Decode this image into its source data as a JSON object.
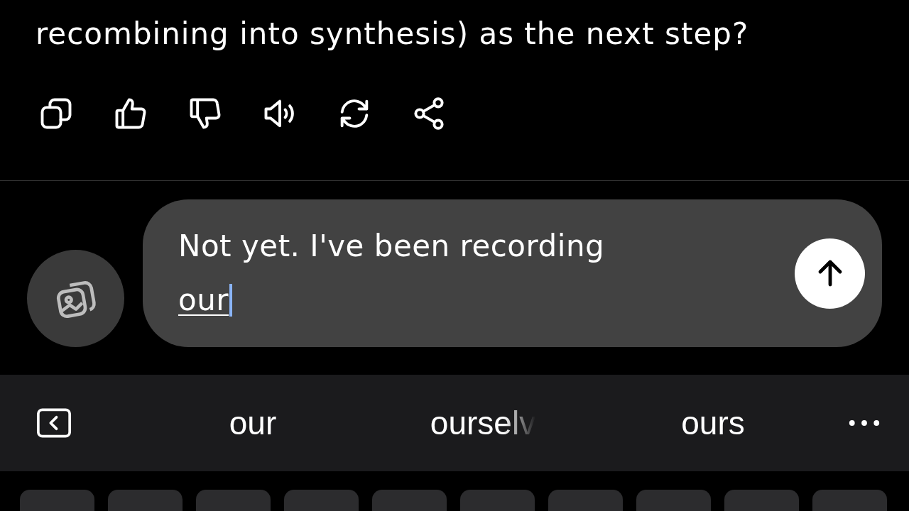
{
  "message": {
    "text": "recombining into synthesis) as the next step?"
  },
  "actions": [
    {
      "kind": "copy"
    },
    {
      "kind": "like"
    },
    {
      "kind": "dislike"
    },
    {
      "kind": "speak"
    },
    {
      "kind": "regenerate"
    },
    {
      "kind": "share"
    }
  ],
  "composer": {
    "value": "Not yet. I've been recording",
    "composing": "our"
  },
  "suggestions": [
    {
      "text": "our",
      "faded": false
    },
    {
      "text": "ourselv",
      "faded": true
    },
    {
      "text": "ours",
      "faded": false
    }
  ],
  "keyboard": {
    "keys": [
      {
        "kind": "key"
      },
      {
        "kind": "key"
      },
      {
        "kind": "key"
      },
      {
        "kind": "key"
      },
      {
        "kind": "key"
      },
      {
        "kind": "key"
      },
      {
        "kind": "key"
      },
      {
        "kind": "key"
      },
      {
        "kind": "key"
      },
      {
        "kind": "key"
      }
    ]
  }
}
